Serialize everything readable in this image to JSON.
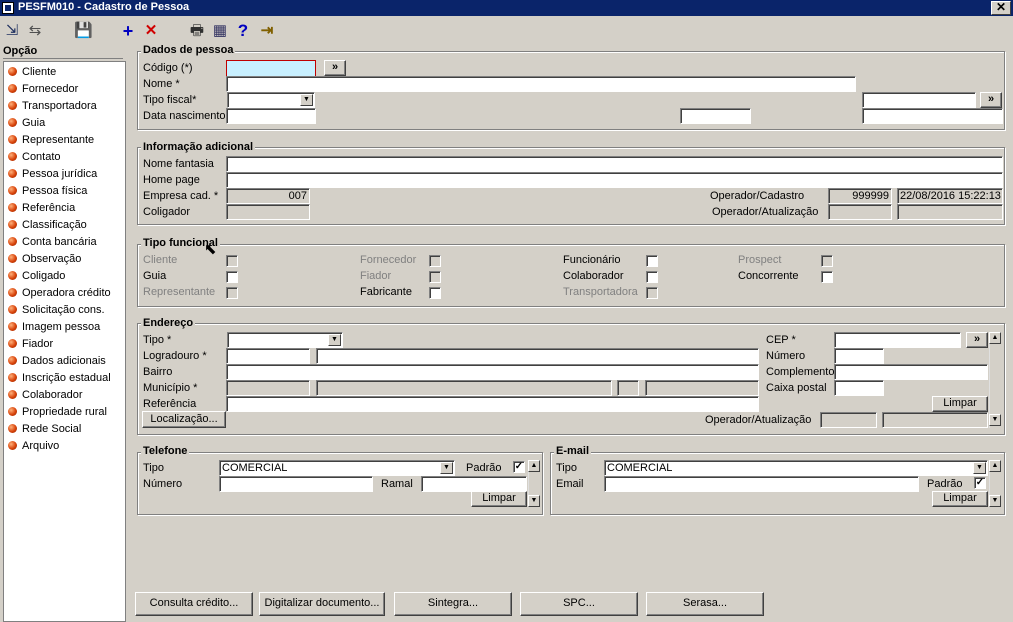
{
  "window": {
    "title": "PESFM010 - Cadastro de Pessoa",
    "close": "✕"
  },
  "toolbar": {
    "icons": [
      "⇲",
      "⇆",
      "💾",
      "+",
      "✕",
      "🖶",
      "▦",
      "?",
      "⇥"
    ]
  },
  "sidebar": {
    "header": "Opção",
    "items": [
      "Cliente",
      "Fornecedor",
      "Transportadora",
      "Guia",
      "Representante",
      "Contato",
      "Pessoa jurídica",
      "Pessoa física",
      "Referência",
      "Classificação",
      "Conta bancária",
      "Observação",
      "Coligado",
      "Operadora crédito",
      "Solicitação cons.",
      "Imagem pessoa",
      "Fiador",
      "Dados adicionais",
      "Inscrição estadual",
      "Colaborador",
      "Propriedade rural",
      "Rede Social",
      "Arquivo"
    ]
  },
  "dados": {
    "title": "Dados de pessoa",
    "codigo": "Código (*)",
    "nome": "Nome *",
    "tipo_fiscal": "Tipo fiscal*",
    "data_nascimento": "Data nascimento",
    "lookup": "»"
  },
  "info": {
    "title": "Informação adicional",
    "nome_fantasia": "Nome fantasia",
    "home_page": "Home page",
    "empresa": "Empresa cad. *",
    "empresa_value": "007",
    "coligador": "Coligador",
    "operador_cadastro": "Operador/Cadastro",
    "operador_cadastro_value": "999999",
    "data_cadastro": "22/08/2016 15:22:13",
    "operador_atualizacao": "Operador/Atualização"
  },
  "tipo_funcional": {
    "title": "Tipo funcional",
    "items": [
      {
        "label": "Cliente",
        "checked": false,
        "disabled": true
      },
      {
        "label": "Guia",
        "checked": false,
        "disabled": false
      },
      {
        "label": "Representante",
        "checked": false,
        "disabled": true
      },
      {
        "label": "Fornecedor",
        "checked": false,
        "disabled": true
      },
      {
        "label": "Fiador",
        "checked": false,
        "disabled": true
      },
      {
        "label": "Fabricante",
        "checked": false,
        "disabled": false
      },
      {
        "label": "Funcionário",
        "checked": false,
        "disabled": false
      },
      {
        "label": "Colaborador",
        "checked": false,
        "disabled": false
      },
      {
        "label": "Transportadora",
        "checked": false,
        "disabled": true
      },
      {
        "label": "Prospect",
        "checked": false,
        "disabled": true
      },
      {
        "label": "Concorrente",
        "checked": false,
        "disabled": false
      }
    ]
  },
  "endereco": {
    "title": "Endereço",
    "tipo": "Tipo *",
    "logradouro": "Logradouro *",
    "bairro": "Bairro",
    "municipio": "Município *",
    "referencia": "Referência",
    "localizacao_button": "Localização...",
    "cep": "CEP *",
    "numero": "Número",
    "complemento": "Complemento",
    "caixa_postal": "Caixa postal",
    "limpar": "Limpar",
    "operador_atualizacao": "Operador/Atualização",
    "lookup": "»"
  },
  "telefone": {
    "title": "Telefone",
    "tipo": "Tipo",
    "tipo_value": "COMERCIAL",
    "padrao": "Padrão",
    "padrao_checked": "✓",
    "numero": "Número",
    "ramal": "Ramal",
    "limpar": "Limpar"
  },
  "email": {
    "title": "E-mail",
    "tipo": "Tipo",
    "tipo_value": "COMERCIAL",
    "email": "Email",
    "padrao": "Padrão",
    "padrao_checked": "✓",
    "limpar": "Limpar"
  },
  "bottom_buttons": [
    "Consulta crédito...",
    "Digitalizar documento...",
    "Sintegra...",
    "SPC...",
    "Serasa..."
  ],
  "colors": {
    "titlebar": "#0a246a",
    "window": "#d4d0c8",
    "focus_border": "#c00000"
  }
}
